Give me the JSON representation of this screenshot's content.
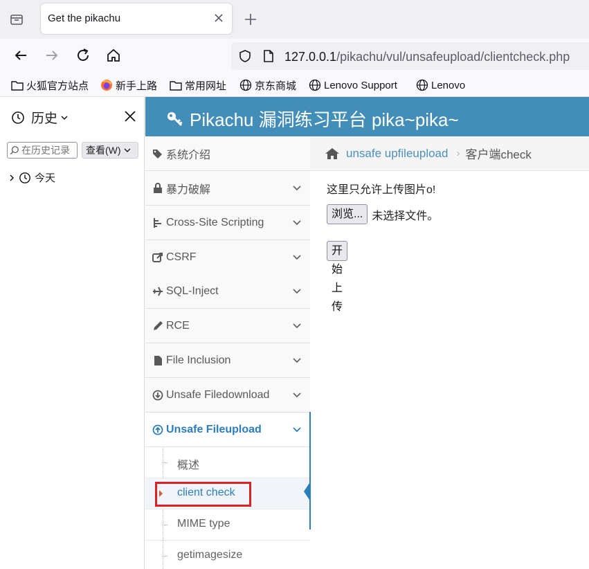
{
  "browser": {
    "tab_title": "Get the pikachu",
    "url_host": "127.0.0.1",
    "url_path": "/pikachu/vul/unsafeupload/clientcheck.php",
    "bookmarks": [
      "火狐官方站点",
      "新手上路",
      "常用网址",
      "京东商城",
      "Lenovo Support",
      "Lenovo"
    ]
  },
  "history": {
    "title": "历史",
    "search_placeholder": "在历史记录",
    "view_label": "查看(W)",
    "today_label": "今天"
  },
  "site": {
    "brand": "Pikachu 漏洞练习平台 pika~pika~",
    "menu": [
      {
        "label": "系统介绍",
        "icon": "tags-icon"
      },
      {
        "label": "暴力破解",
        "icon": "lock-icon"
      },
      {
        "label": "Cross-Site Scripting",
        "icon": "tree-icon"
      },
      {
        "label": "CSRF",
        "icon": "share-icon"
      },
      {
        "label": "SQL-Inject",
        "icon": "plane-icon"
      },
      {
        "label": "RCE",
        "icon": "pencil-icon"
      },
      {
        "label": "File Inclusion",
        "icon": "file-icon"
      },
      {
        "label": "Unsafe Filedownload",
        "icon": "download-icon"
      },
      {
        "label": "Unsafe Fileupload",
        "icon": "upload-icon"
      }
    ],
    "submenu": [
      "概述",
      "client check",
      "MIME type",
      "getimagesize"
    ],
    "breadcrumb": {
      "parent": "unsafe upfileupload",
      "current": "客户端check"
    },
    "notice": "这里只允许上传图片o!",
    "browse_label": "浏览...",
    "file_status": "未选择文件。",
    "upload_label": "开始上传"
  },
  "colors": {
    "header_blue": "#438eb9",
    "link_blue": "#2b7dbc",
    "highlight_red": "#e02020"
  }
}
